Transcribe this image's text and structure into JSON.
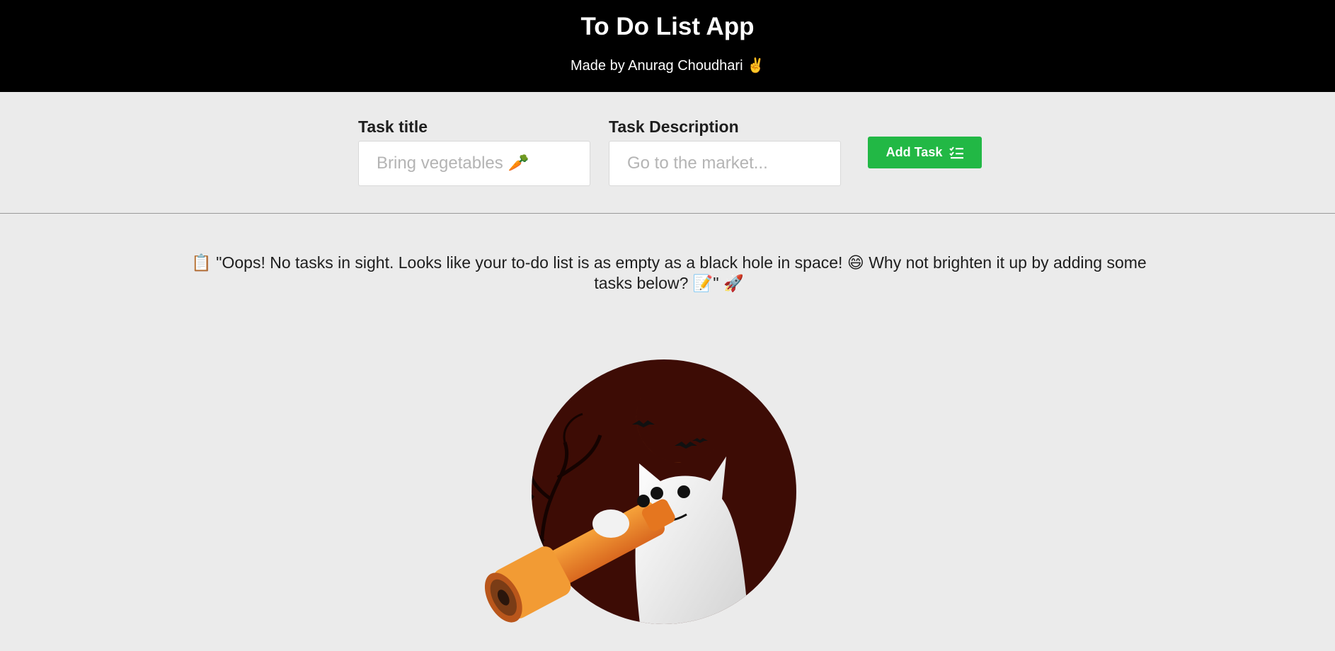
{
  "header": {
    "title": "To Do List App",
    "subtitle": "Made by Anurag Choudhari ✌️"
  },
  "form": {
    "title_field": {
      "label": "Task title",
      "placeholder": "Bring vegetables 🥕",
      "value": ""
    },
    "description_field": {
      "label": "Task Description",
      "placeholder": "Go to the market...",
      "value": ""
    },
    "add_button": {
      "label": "Add Task",
      "icon": "checklist-icon"
    }
  },
  "empty_state": {
    "message": "📋 \"Oops! No tasks in sight. Looks like your to-do list is as empty as a black hole in space! 😄 Why not brighten it up by adding some tasks below? 📝\" 🚀",
    "illustration": "ghost-with-telescope-illustration"
  },
  "colors": {
    "header_bg": "#000000",
    "page_bg": "#ebebeb",
    "accent_green": "#22b845"
  }
}
